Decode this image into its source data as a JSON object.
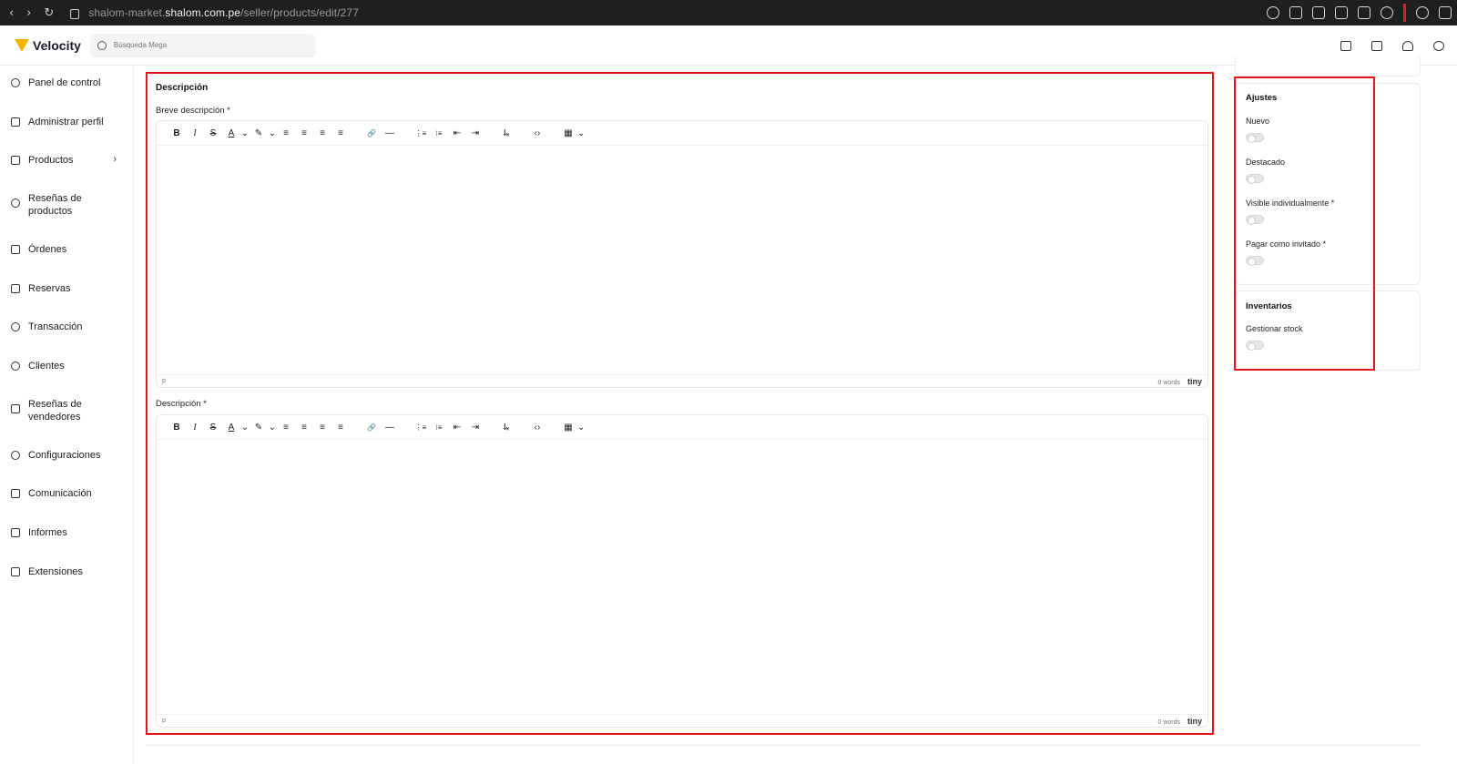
{
  "browser": {
    "url_host_prefix": "shalom-market.",
    "url_host": "shalom.com.pe",
    "url_path": "/seller/products/edit/277",
    "nav": {
      "back": "‹",
      "forward": "›",
      "reload": "↻"
    }
  },
  "header": {
    "logo_text": "Velocity",
    "search_placeholder": "Búsqueda Mega"
  },
  "sidebar": {
    "items": [
      {
        "label": "Panel de control",
        "icon": "dashboard-icon"
      },
      {
        "label": "Administrar perfil",
        "icon": "profile-icon"
      },
      {
        "label": "Productos",
        "icon": "products-icon"
      },
      {
        "label": "Reseñas de productos",
        "icon": "star-icon"
      },
      {
        "label": "Órdenes",
        "icon": "orders-icon"
      },
      {
        "label": "Reservas",
        "icon": "calendar-icon"
      },
      {
        "label": "Transacción",
        "icon": "transaction-icon"
      },
      {
        "label": "Clientes",
        "icon": "customers-icon"
      },
      {
        "label": "Reseñas de vendedores",
        "icon": "seller-review-icon"
      },
      {
        "label": "Configuraciones",
        "icon": "settings-icon"
      },
      {
        "label": "Comunicación",
        "icon": "chat-icon"
      },
      {
        "label": "Informes",
        "icon": "reports-icon"
      },
      {
        "label": "Extensiones",
        "icon": "extensions-icon"
      }
    ],
    "productos_chevron": "›"
  },
  "main": {
    "section_title": "Descripción",
    "short_label": "Breve descripción",
    "desc_label": "Descripción",
    "required_mark": "*",
    "toolbar": {
      "bold": "B",
      "italic": "I",
      "strike": "S",
      "text_color": "A",
      "highlight": "✎",
      "dropdown": "⌄",
      "align_left": "≡",
      "align_center": "≡",
      "align_right": "≡",
      "justify": "≡",
      "link": "🔗",
      "hr": "—",
      "ordered_list": "⋮≡",
      "bullet_list": "⁝≡",
      "outdent": "⇤",
      "indent": "⇥",
      "clear_format": "I̶ₓ",
      "code": "‹›",
      "table": "▦"
    },
    "status": {
      "path": "p",
      "words": "0 words",
      "brand": "tiny"
    }
  },
  "right": {
    "settings": {
      "title": "Ajustes",
      "items": [
        {
          "label": "Nuevo",
          "required": false,
          "on": false
        },
        {
          "label": "Destacado",
          "required": false,
          "on": false
        },
        {
          "label": "Visible individualmente",
          "required": true,
          "on": false
        },
        {
          "label": "Pagar como invitado",
          "required": true,
          "on": false
        }
      ]
    },
    "inventory": {
      "title": "Inventarios",
      "items": [
        {
          "label": "Gestionar stock",
          "on": false
        }
      ]
    }
  },
  "colors": {
    "highlight_border": "#e3141b",
    "browser_bg": "#1f1f1f",
    "logo_accent": "#f4b400"
  }
}
